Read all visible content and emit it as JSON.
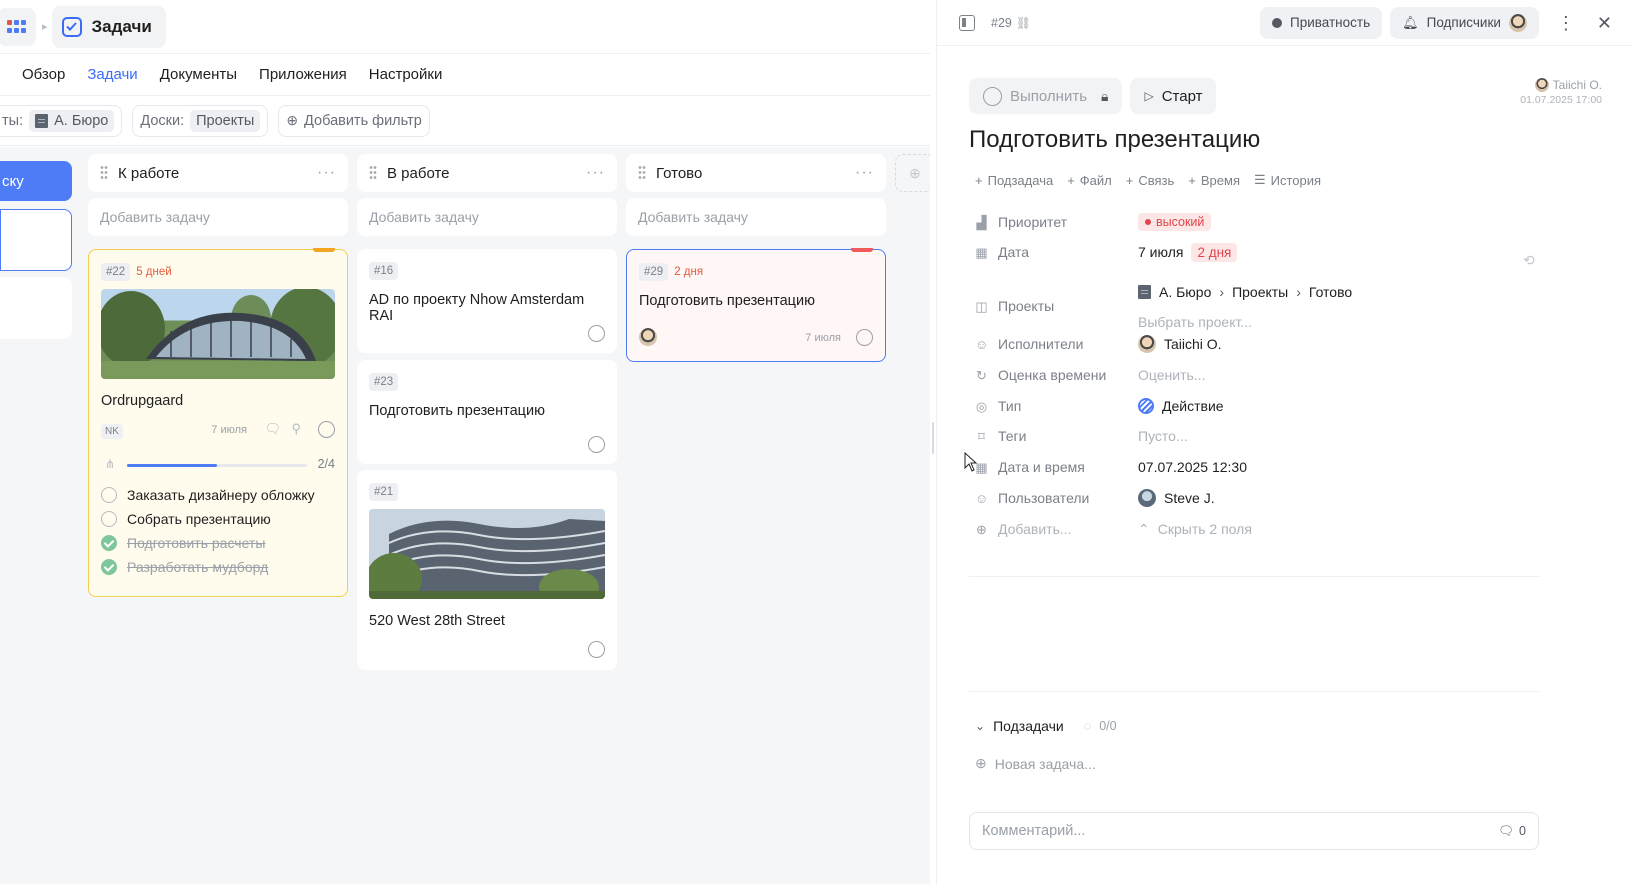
{
  "app": {
    "title": "Задачи"
  },
  "nav": {
    "tabs": [
      "Обзор",
      "Задачи",
      "Документы",
      "Приложения",
      "Настройки"
    ],
    "active": "Задачи"
  },
  "filters": {
    "owner_label": "ты:",
    "owner_value": "А. Бюро",
    "boards_label": "Доски:",
    "boards_value": "Проекты",
    "add_filter": "Добавить фильтр"
  },
  "board": {
    "left_button": "ску",
    "columns": [
      {
        "title": "К работе",
        "add_label": "Добавить задачу"
      },
      {
        "title": "В работе",
        "add_label": "Добавить задачу"
      },
      {
        "title": "Готово",
        "add_label": "Добавить задачу"
      }
    ],
    "cards": {
      "c22": {
        "id": "#22",
        "due": "5 дней",
        "title": "Ordrupgaard",
        "initials": "NK",
        "date": "7 июля",
        "progress_text": "2/4",
        "progress": 0.5,
        "subtasks": [
          {
            "label": "Заказать дизайнеру обложку",
            "done": false
          },
          {
            "label": "Собрать презентацию",
            "done": false
          },
          {
            "label": "Подготовить расчеты",
            "done": true
          },
          {
            "label": "Разработать мудборд",
            "done": true
          }
        ]
      },
      "c16": {
        "id": "#16",
        "title": "AD по проекту Nhow Amsterdam RAI"
      },
      "c23": {
        "id": "#23",
        "title": "Подготовить презентацию"
      },
      "c21": {
        "id": "#21",
        "title": "520 West 28th Street"
      },
      "c29": {
        "id": "#29",
        "due": "2 дня",
        "title": "Подготовить презентацию",
        "date": "7 июля"
      }
    }
  },
  "panel": {
    "task_id": "#29",
    "privacy": "Приватность",
    "subscribers": "Подписчики",
    "complete_btn": "Выполнить",
    "start_btn": "Старт",
    "author": "Taiichi O.",
    "created": "01.07.2025 17:00",
    "title": "Подготовить презентацию",
    "actions": [
      "Подзадача",
      "Файл",
      "Связь",
      "Время",
      "История"
    ],
    "fields": {
      "priority_label": "Приоритет",
      "priority_value": "высокий",
      "date_label": "Дата",
      "date_value": "7 июля",
      "date_left": "2 дня",
      "projects_label": "Проекты",
      "projects_path": [
        "А. Бюро",
        "Проекты",
        "Готово"
      ],
      "projects_pick": "Выбрать проект...",
      "assignees_label": "Исполнители",
      "assignees_value": "Taiichi O.",
      "estimate_label": "Оценка времени",
      "estimate_value": "Оценить...",
      "type_label": "Тип",
      "type_value": "Действие",
      "tags_label": "Теги",
      "tags_value": "Пусто...",
      "datetime_label": "Дата и время",
      "datetime_value": "07.07.2025 12:30",
      "users_label": "Пользователи",
      "users_value": "Steve J.",
      "add_label": "Добавить...",
      "hide_label": "Скрыть 2 поля"
    },
    "subtasks_label": "Подзадачи",
    "subtasks_count": "0/0",
    "new_task": "Новая задача...",
    "comment_placeholder": "Комментарий...",
    "comment_count": "0"
  }
}
